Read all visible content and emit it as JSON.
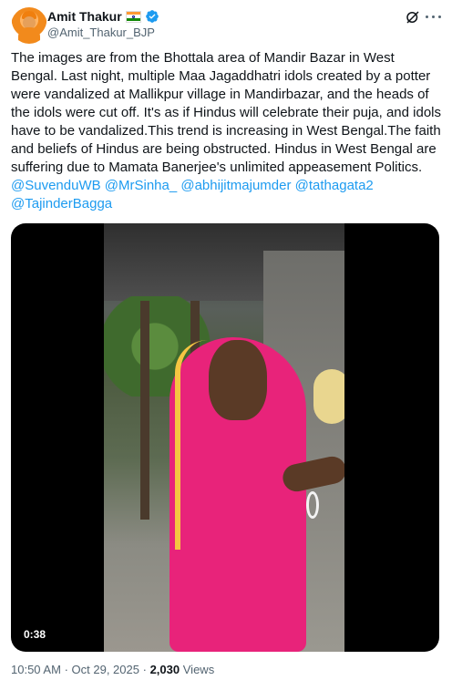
{
  "author": {
    "name": "Amit Thakur",
    "handle": "@Amit_Thakur_BJP",
    "flag_icon": "indian-flag",
    "verified_icon": "verified-badge",
    "verified_color": "#1d9bf0"
  },
  "tweet": {
    "text": "The images are from the Bhottala area of Mandir Bazar in West Bengal. Last night, multiple Maa Jagaddhatri idols created by a potter were vandalized at Mallikpur village in Mandirbazar, and the heads of the idols were cut off. It's as if Hindus will celebrate their puja, and idols have to be vandalized.This trend is increasing in West Bengal.The faith and beliefs of Hindus are being obstructed. Hindus in West Bengal are suffering due to Mamata Banerjee's unlimited appeasement Politics.",
    "mentions": "@SuvenduWB @MrSinha_ @abhijitmajumder @tathagata2 @TajinderBagga",
    "mention_color": "#1d9bf0"
  },
  "media": {
    "duration": "0:38"
  },
  "meta": {
    "time": "10:50 AM",
    "date": "Oct 29, 2025",
    "separator": "·",
    "views_count": "2,030",
    "views_label": "Views"
  }
}
